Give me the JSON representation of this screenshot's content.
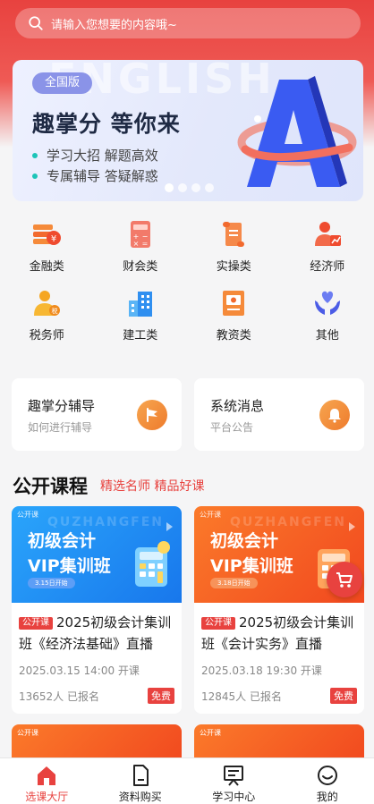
{
  "search": {
    "placeholder": "请输入您想要的内容哦~",
    "icon": "search-icon"
  },
  "banner": {
    "tag": "全国版",
    "title": "趣掌分 等你来",
    "points": [
      "学习大招 解题高效",
      "专属辅导 答疑解惑"
    ],
    "bg_word": "ENGLISH",
    "slides": 4,
    "active_slide": 0
  },
  "categories": [
    {
      "label": "金融类",
      "icon": "finance-icon"
    },
    {
      "label": "财会类",
      "icon": "calculator-icon"
    },
    {
      "label": "实操类",
      "icon": "scroll-icon"
    },
    {
      "label": "经济师",
      "icon": "economist-icon"
    },
    {
      "label": "税务师",
      "icon": "tax-advisor-icon"
    },
    {
      "label": "建工类",
      "icon": "building-icon"
    },
    {
      "label": "教资类",
      "icon": "certificate-icon"
    },
    {
      "label": "其他",
      "icon": "heart-hands-icon"
    }
  ],
  "quick_cards": [
    {
      "title": "趣掌分辅导",
      "subtitle": "如何进行辅导",
      "icon": "flag-icon"
    },
    {
      "title": "系统消息",
      "subtitle": "平台公告",
      "icon": "bell-icon"
    }
  ],
  "section": {
    "title": "公开课程",
    "subtitle": "精选名师 精品好课"
  },
  "courses": [
    {
      "mini_tag": "公开课",
      "watermark": "QUZHANGFEN",
      "thumb_line1": "初级会计",
      "thumb_line2": "VIP集训班",
      "thumb_date": "3.15日开始",
      "badge": "公开课",
      "name": "2025初级会计集训班《经济法基础》直播",
      "time": "2025.03.15 14:00 开课",
      "enrolled": "13652人 已报名",
      "price": "免费",
      "theme": "#1c8df2"
    },
    {
      "mini_tag": "公开课",
      "watermark": "QUZHANGFEN",
      "thumb_line1": "初级会计",
      "thumb_line2": "VIP集训班",
      "thumb_date": "3.18日开始",
      "badge": "公开课",
      "name": "2025初级会计集训班《会计实务》直播",
      "time": "2025.03.18 19:30 开课",
      "enrolled": "12845人 已报名",
      "price": "免费",
      "theme": "#f25a22"
    }
  ],
  "peek_courses": [
    {
      "mini_tag": "公开课"
    },
    {
      "mini_tag": "公开课"
    }
  ],
  "cart": {
    "icon": "cart-icon"
  },
  "tabbar": [
    {
      "label": "选课大厅",
      "icon": "home-icon",
      "active": true
    },
    {
      "label": "资料购买",
      "icon": "document-icon",
      "active": false
    },
    {
      "label": "学习中心",
      "icon": "study-center-icon",
      "active": false
    },
    {
      "label": "我的",
      "icon": "smile-icon",
      "active": false
    }
  ],
  "colors": {
    "brand": "#e8423f",
    "accent_orange": "#ee7b2c",
    "teal_dot": "#1cc4b8"
  }
}
